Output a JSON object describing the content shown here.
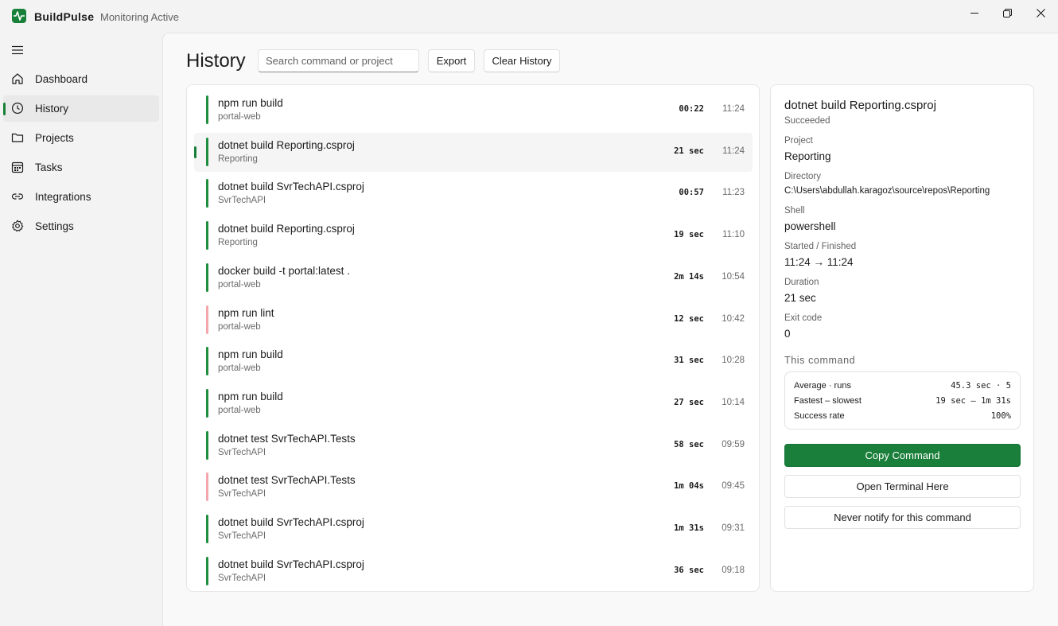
{
  "app": {
    "name": "BuildPulse",
    "status": "Monitoring Active"
  },
  "colors": {
    "accent": "#188038",
    "success_bar": "#1e8e3e",
    "failure_bar": "#f4a6ad"
  },
  "sidebar": {
    "items": [
      {
        "label": "Dashboard",
        "icon": "home-icon",
        "active": false
      },
      {
        "label": "History",
        "icon": "clock-icon",
        "active": true
      },
      {
        "label": "Projects",
        "icon": "folder-icon",
        "active": false
      },
      {
        "label": "Tasks",
        "icon": "calendar-icon",
        "active": false
      },
      {
        "label": "Integrations",
        "icon": "link-icon",
        "active": false
      },
      {
        "label": "Settings",
        "icon": "gear-icon",
        "active": false
      }
    ]
  },
  "header": {
    "title": "History",
    "search_placeholder": "Search command or project",
    "export_label": "Export",
    "clear_label": "Clear History"
  },
  "history": [
    {
      "command": "npm run build",
      "project": "portal-web",
      "duration": "00:22",
      "time": "11:24",
      "status": "success",
      "selected": false
    },
    {
      "command": "dotnet build Reporting.csproj",
      "project": "Reporting",
      "duration": "21 sec",
      "time": "11:24",
      "status": "success",
      "selected": true
    },
    {
      "command": "dotnet build SvrTechAPI.csproj",
      "project": "SvrTechAPI",
      "duration": "00:57",
      "time": "11:23",
      "status": "success",
      "selected": false
    },
    {
      "command": "dotnet build Reporting.csproj",
      "project": "Reporting",
      "duration": "19 sec",
      "time": "11:10",
      "status": "success",
      "selected": false
    },
    {
      "command": "docker build -t portal:latest .",
      "project": "portal-web",
      "duration": "2m 14s",
      "time": "10:54",
      "status": "success",
      "selected": false
    },
    {
      "command": "npm run lint",
      "project": "portal-web",
      "duration": "12 sec",
      "time": "10:42",
      "status": "failure",
      "selected": false
    },
    {
      "command": "npm run build",
      "project": "portal-web",
      "duration": "31 sec",
      "time": "10:28",
      "status": "success",
      "selected": false
    },
    {
      "command": "npm run build",
      "project": "portal-web",
      "duration": "27 sec",
      "time": "10:14",
      "status": "success",
      "selected": false
    },
    {
      "command": "dotnet test SvrTechAPI.Tests",
      "project": "SvrTechAPI",
      "duration": "58 sec",
      "time": "09:59",
      "status": "success",
      "selected": false
    },
    {
      "command": "dotnet test SvrTechAPI.Tests",
      "project": "SvrTechAPI",
      "duration": "1m 04s",
      "time": "09:45",
      "status": "failure",
      "selected": false
    },
    {
      "command": "dotnet build SvrTechAPI.csproj",
      "project": "SvrTechAPI",
      "duration": "1m 31s",
      "time": "09:31",
      "status": "success",
      "selected": false
    },
    {
      "command": "dotnet build SvrTechAPI.csproj",
      "project": "SvrTechAPI",
      "duration": "36 sec",
      "time": "09:18",
      "status": "success",
      "selected": false
    }
  ],
  "detail": {
    "title": "dotnet build Reporting.csproj",
    "status": "Succeeded",
    "project_label": "Project",
    "project": "Reporting",
    "directory_label": "Directory",
    "directory": "C:\\Users\\abdullah.karagoz\\source\\repos\\Reporting",
    "shell_label": "Shell",
    "shell": "powershell",
    "started_label": "Started / Finished",
    "started": "11:24 → 11:24",
    "duration_label": "Duration",
    "duration": "21 sec",
    "exit_label": "Exit code",
    "exit_code": "0",
    "section_title": "This command",
    "stats": {
      "avg_label": "Average · runs",
      "avg_value": "45.3 sec · 5",
      "range_label": "Fastest – slowest",
      "range_value": "19 sec – 1m 31s",
      "success_label": "Success rate",
      "success_value": "100%"
    },
    "copy_label": "Copy Command",
    "terminal_label": "Open Terminal Here",
    "mute_label": "Never notify for this command"
  }
}
